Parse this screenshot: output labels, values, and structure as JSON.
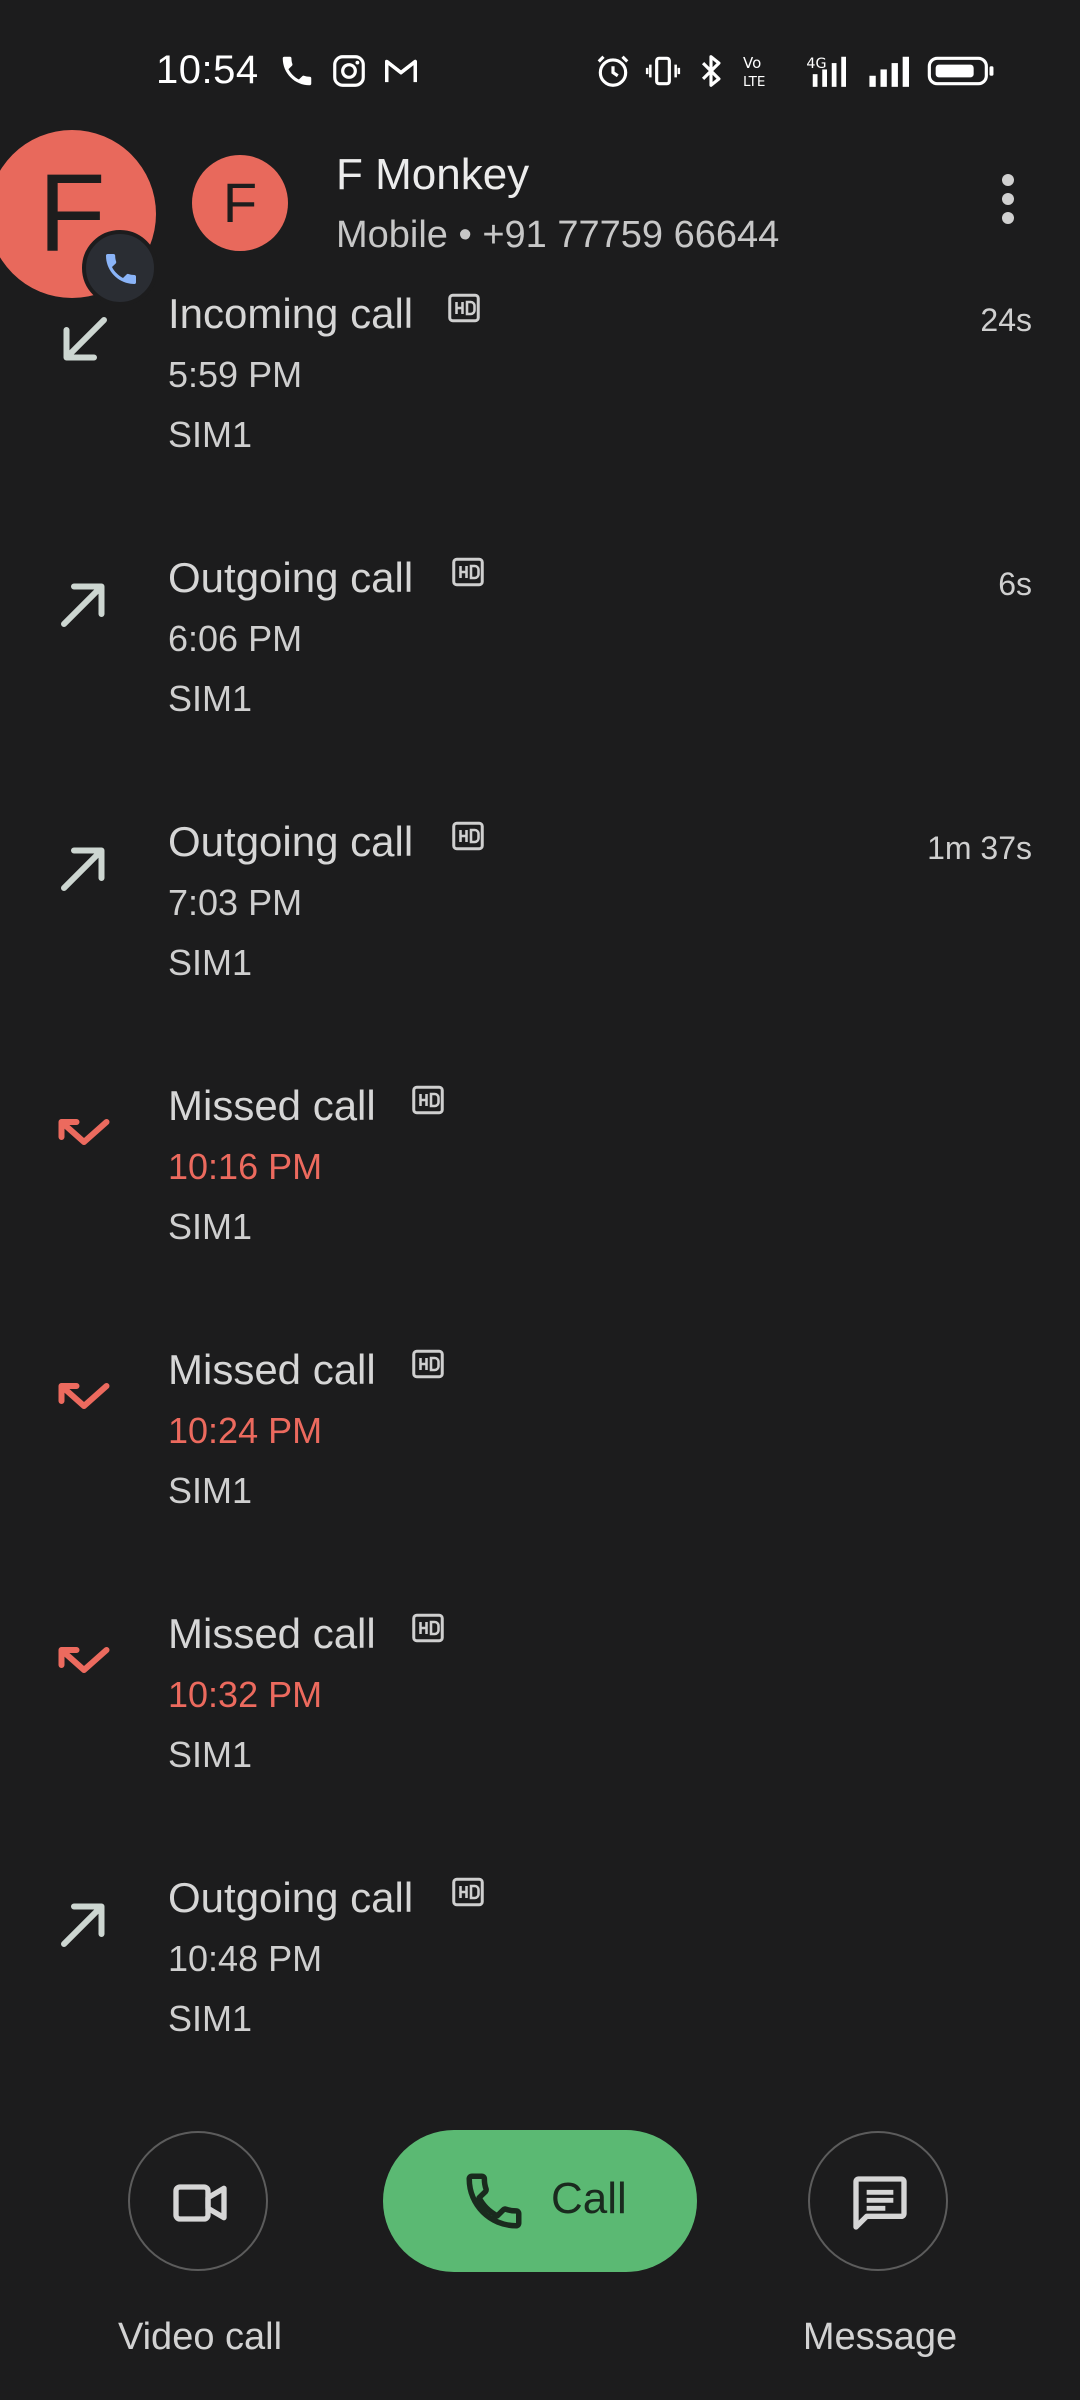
{
  "status_bar": {
    "time": "10:54"
  },
  "bubble": {
    "initial": "F"
  },
  "contact": {
    "initial": "F",
    "name": "F Monkey",
    "subtitle": "Mobile • +91 77759 66644",
    "avatar_color": "#e8695c"
  },
  "calls": [
    {
      "type": "Incoming call",
      "time": "5:59 PM",
      "sim": "SIM1",
      "duration": "24s",
      "direction": "incoming"
    },
    {
      "type": "Outgoing call",
      "time": "6:06 PM",
      "sim": "SIM1",
      "duration": "6s",
      "direction": "outgoing"
    },
    {
      "type": "Outgoing call",
      "time": "7:03 PM",
      "sim": "SIM1",
      "duration": "1m 37s",
      "direction": "outgoing"
    },
    {
      "type": "Missed call",
      "time": "10:16 PM",
      "sim": "SIM1",
      "duration": "",
      "direction": "missed"
    },
    {
      "type": "Missed call",
      "time": "10:24 PM",
      "sim": "SIM1",
      "duration": "",
      "direction": "missed"
    },
    {
      "type": "Missed call",
      "time": "10:32 PM",
      "sim": "SIM1",
      "duration": "",
      "direction": "missed"
    },
    {
      "type": "Outgoing call",
      "time": "10:48 PM",
      "sim": "SIM1",
      "duration": "",
      "direction": "outgoing"
    }
  ],
  "actions": {
    "video_call_label": "Video call",
    "call_label": "Call",
    "message_label": "Message"
  },
  "colors": {
    "background": "#1c1c1d",
    "missed": "#ec6a5e",
    "call_button": "#5bb973"
  }
}
